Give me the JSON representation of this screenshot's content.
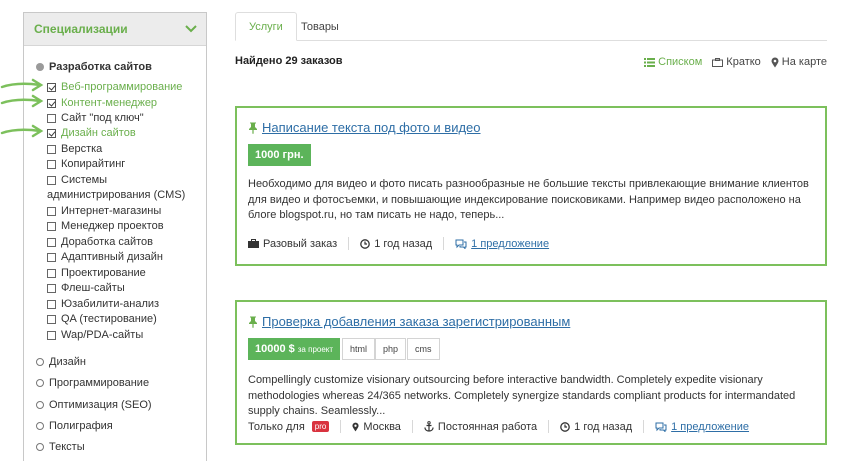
{
  "sidebar": {
    "title": "Специализации",
    "categories": [
      {
        "label": "Разработка сайтов",
        "active": true
      },
      {
        "label": "Дизайн"
      },
      {
        "label": "Программирование"
      },
      {
        "label": "Оптимизация (SEO)"
      },
      {
        "label": "Полиграфия"
      },
      {
        "label": "Тексты"
      }
    ],
    "subcategories": [
      {
        "label": "Веб-программирование",
        "checked": true
      },
      {
        "label": "Контент-менеджер",
        "checked": true
      },
      {
        "label": "Сайт \"под ключ\"",
        "checked": false
      },
      {
        "label": "Дизайн сайтов",
        "checked": true
      },
      {
        "label": "Верстка",
        "checked": false
      },
      {
        "label": "Копирайтинг",
        "checked": false
      },
      {
        "label": "Системы",
        "checked": false,
        "continuation": "администрирования (CMS)"
      },
      {
        "label": "Интернет-магазины",
        "checked": false
      },
      {
        "label": "Менеджер проектов",
        "checked": false
      },
      {
        "label": "Доработка сайтов",
        "checked": false
      },
      {
        "label": "Адаптивный дизайн",
        "checked": false
      },
      {
        "label": "Проектирование",
        "checked": false
      },
      {
        "label": "Флеш-сайты",
        "checked": false
      },
      {
        "label": "Юзабилити-анализ",
        "checked": false
      },
      {
        "label": "QA (тестирование)",
        "checked": false
      },
      {
        "label": "Wap/PDA-сайты",
        "checked": false
      }
    ]
  },
  "tabs": [
    {
      "label": "Услуги",
      "active": true
    },
    {
      "label": "Товары",
      "active": false
    }
  ],
  "found_text": "Найдено 29 заказов",
  "views": [
    {
      "label": "Списком",
      "icon": "list-icon",
      "active": true
    },
    {
      "label": "Кратко",
      "icon": "briefcase-icon",
      "active": false
    },
    {
      "label": "На карте",
      "icon": "map-marker-icon",
      "active": false
    }
  ],
  "orders": [
    {
      "title": "Написание текста под фото и видео",
      "price": "1000 грн.",
      "description": "Необходимо для видео и фото писать разнообразные не большие тексты привлекающие внимание клиентов для видео и фотосъемки, и повышающие индексирование поисковиками. Например видео расположено на блоге blogspot.ru, но там писать не надо, теперь...",
      "type": "Разовый заказ",
      "time": "1 год назад",
      "offers": "1 предложение"
    },
    {
      "title": "Проверка добавления заказа зарегистрированным",
      "price": "10000 $",
      "price_note": "за проект",
      "tags": [
        "html",
        "php",
        "cms"
      ],
      "description": "Compellingly customize visionary outsourcing before interactive bandwidth. Completely expedite visionary methodologies whereas 24/365 networks. Completely synergize standards compliant products for intermandated supply chains. Seamlessly...",
      "only_for": "Только для",
      "only_for_badge": "pro",
      "location": "Москва",
      "employment": "Постоянная работа",
      "time": "1 год назад",
      "offers": "1 предложение"
    }
  ],
  "colors": {
    "accent": "#6aaf4c",
    "price_bg": "#5cb45a",
    "link": "#2e6ea6",
    "pro_badge": "#d9333f",
    "card_border": "#7cc05c"
  }
}
